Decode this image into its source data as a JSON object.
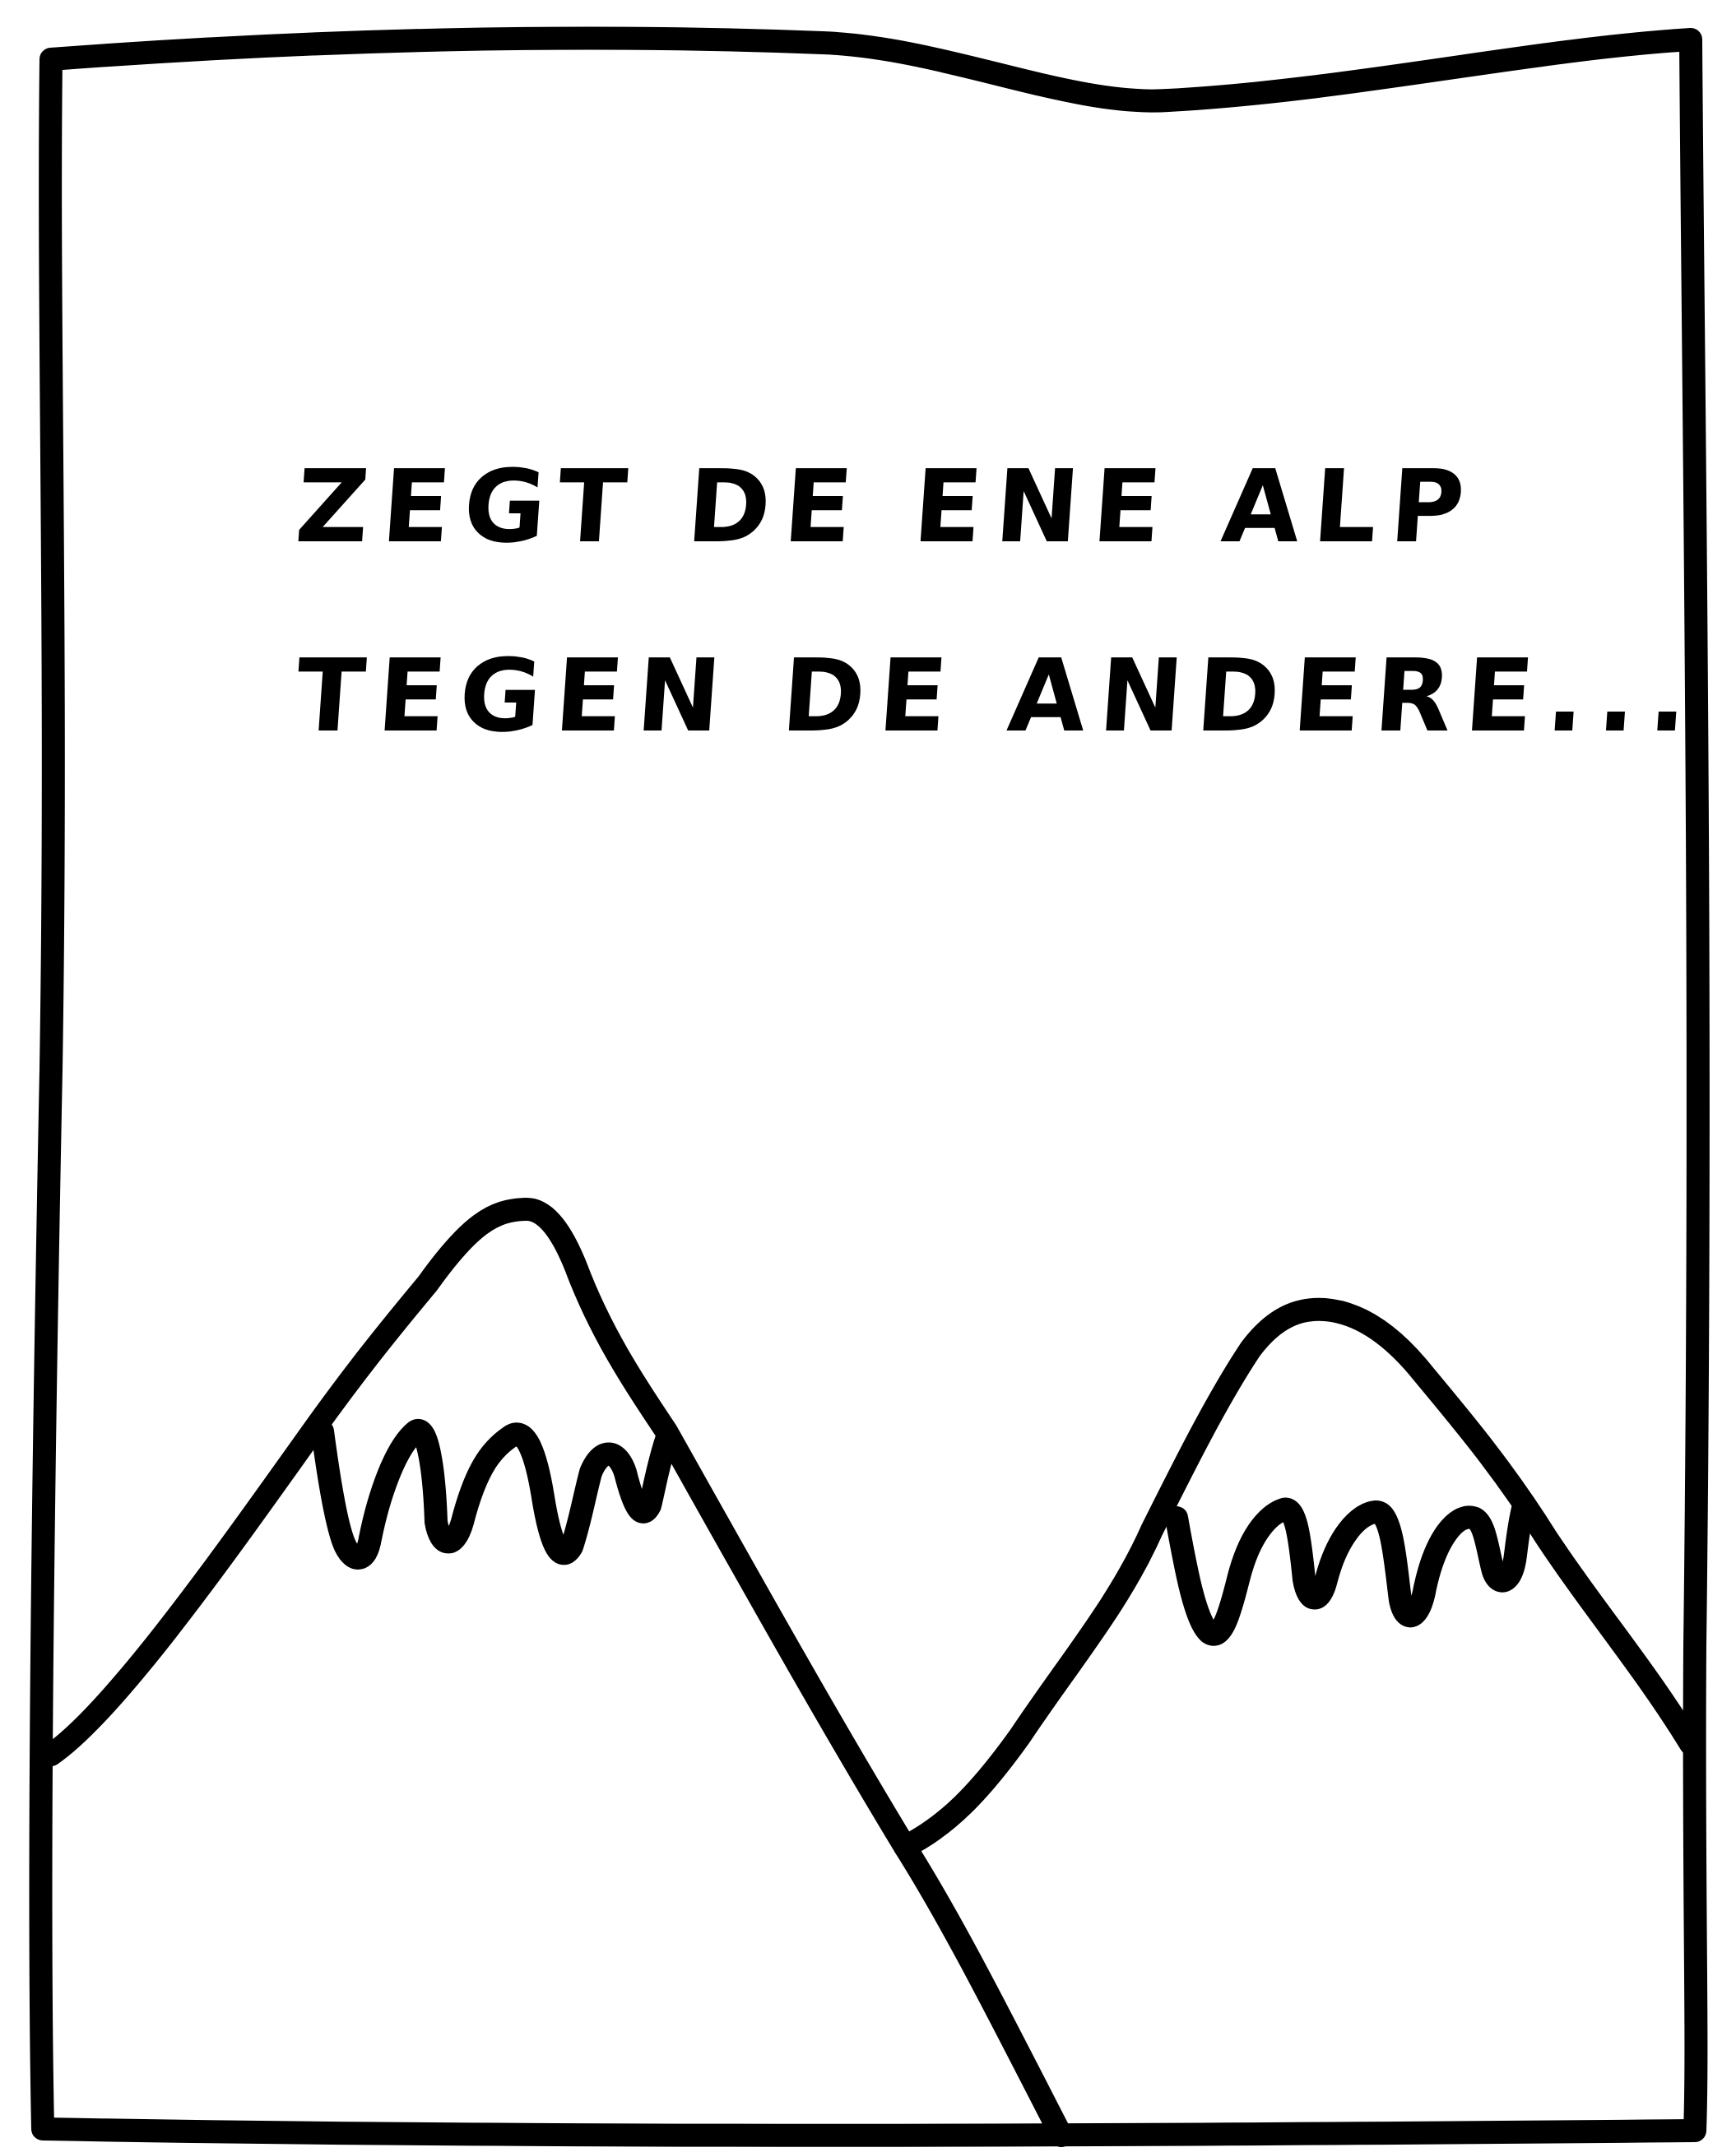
{
  "panel": {
    "caption_lines": [
      "ZEGT DE ENE ALP",
      "TEGEN DE ANDERE..."
    ],
    "ink_color": "#000000",
    "paper_color": "#ffffff"
  }
}
